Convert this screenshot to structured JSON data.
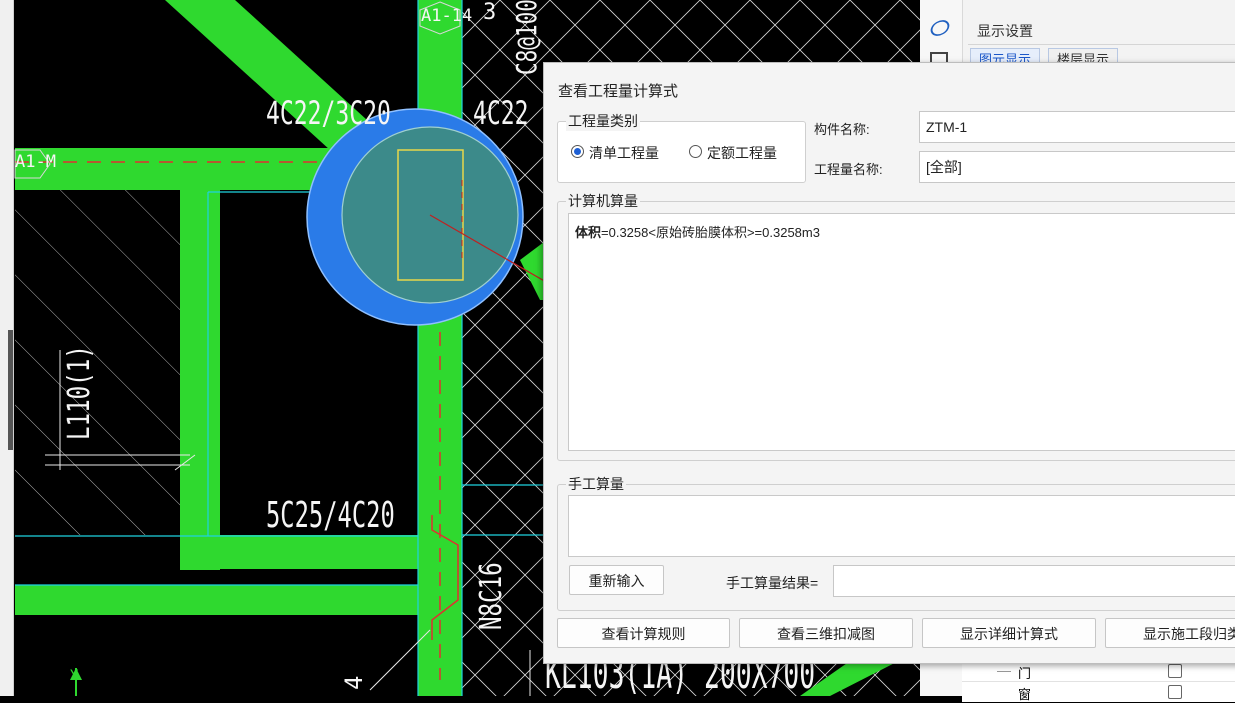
{
  "cad": {
    "axis_top": "A1-14",
    "axis_left": "A1-M",
    "rebar_top_left": "4C22/3C20",
    "rebar_top_right": "4C22",
    "rebar_vertical_top": "C8@100",
    "rebar_top_digit": "3",
    "beam_left_vertical": "L110(1)",
    "rebar_lower_left": "5C25/4C20",
    "rebar_vertical_mid": "N8C16",
    "beam_bottom": "KL103(1A) 200X700",
    "dim_bottom": "4",
    "ucs_y": "Y"
  },
  "right_panel": {
    "title": "显示设置",
    "tabs": [
      "图元显示",
      "楼层显示"
    ],
    "rows": [
      {
        "label": "门",
        "checked": false
      },
      {
        "label": "窗",
        "checked": false
      }
    ]
  },
  "dialog": {
    "title": "查看工程量计算式",
    "quantity_type_group": "工程量类别",
    "radio_bill": "清单工程量",
    "radio_quota": "定额工程量",
    "radio_selected": "清单工程量",
    "component_name_label": "构件名称:",
    "component_name_value": "ZTM-1",
    "quantity_name_label": "工程量名称:",
    "quantity_name_value": "[全部]",
    "computer_calc_group": "计算机算量",
    "calc_result_key": "体积",
    "calc_result_rest": "=0.3258<原始砖胎膜体积>=0.3258m3",
    "manual_calc_group": "手工算量",
    "reinput_button": "重新输入",
    "manual_result_label": "手工算量结果=",
    "manual_result_value": "",
    "buttons": [
      "查看计算规则",
      "查看三维扣减图",
      "显示详细计算式",
      "显示施工段归类"
    ]
  },
  "colors": {
    "beam_green": "#2fd92f",
    "column_blue": "#2a7be8",
    "cyan_line": "#1fd3e0",
    "dialog_bg": "#f4f4f4",
    "accent_blue": "#1e5fd4"
  }
}
